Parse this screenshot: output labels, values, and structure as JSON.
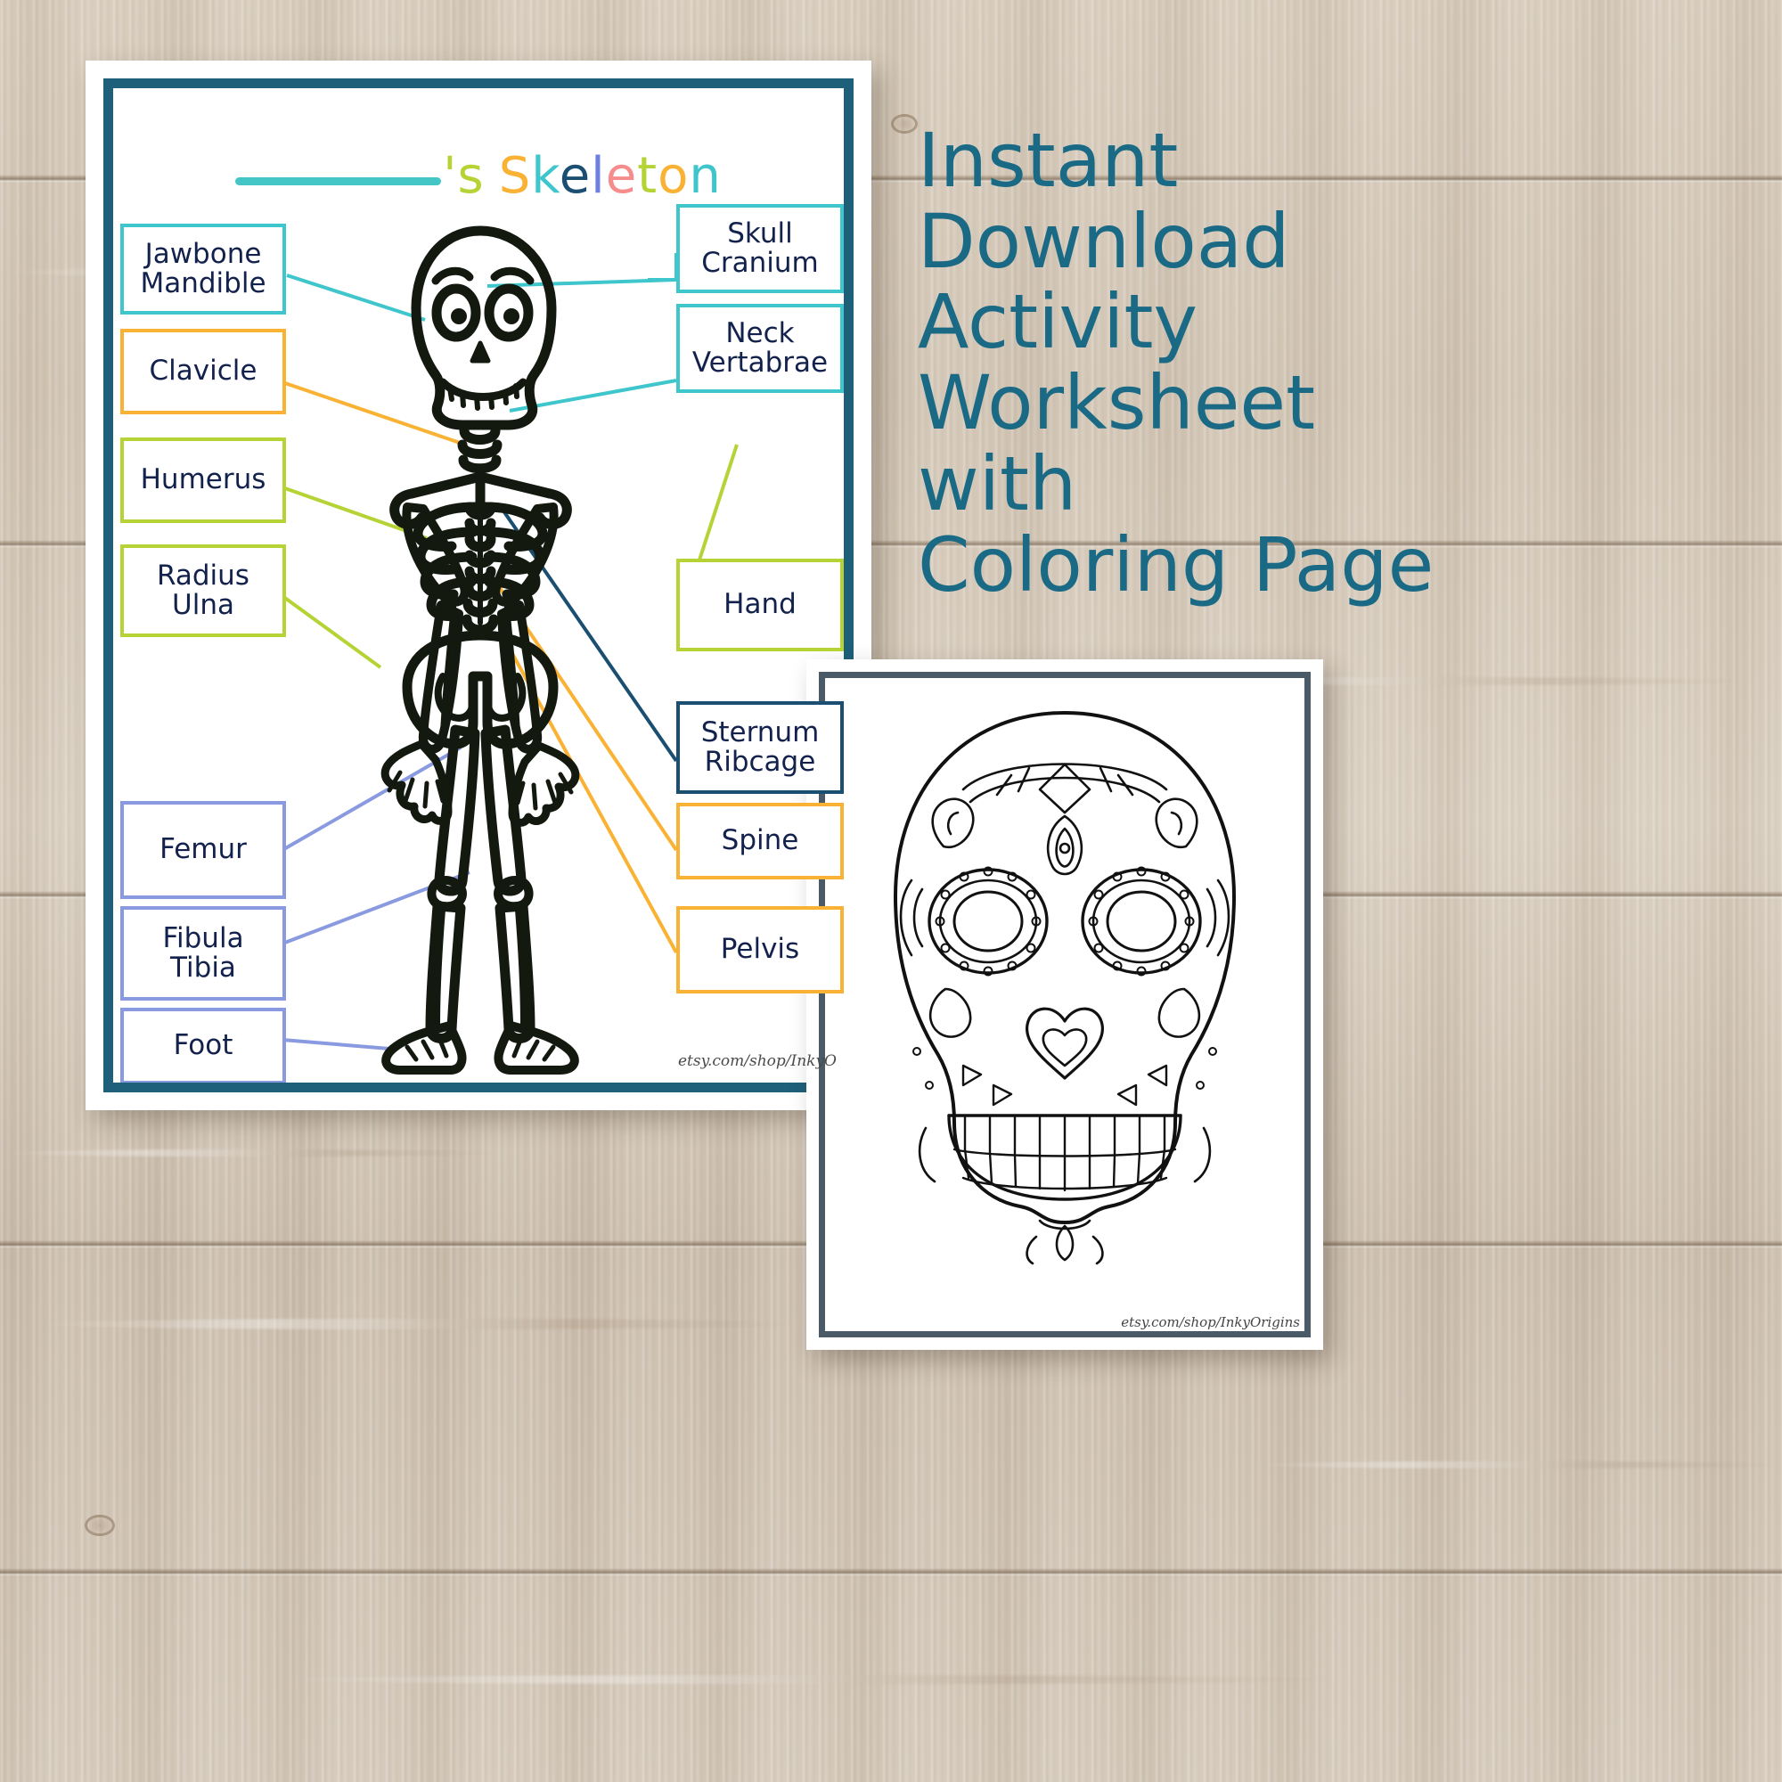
{
  "promo": {
    "lines": [
      "Instant",
      "Download",
      "Activity",
      "Worksheet",
      "with",
      "Coloring Page"
    ],
    "color": "#1a6a85"
  },
  "worksheet": {
    "border_color": "#1e5f7a",
    "title": {
      "blank_line": "",
      "apostrophe_s": "'s",
      "word": "Skeleton",
      "letters": [
        {
          "ch": "'",
          "color": "#b5d334"
        },
        {
          "ch": "s",
          "color": "#b5d334"
        },
        {
          "ch": "S",
          "color": "#f9b233"
        },
        {
          "ch": "k",
          "color": "#3fc6cc"
        },
        {
          "ch": "e",
          "color": "#1a4f72"
        },
        {
          "ch": "l",
          "color": "#6f7fe0"
        },
        {
          "ch": "e",
          "color": "#f78c8c"
        },
        {
          "ch": "t",
          "color": "#b5d334"
        },
        {
          "ch": "o",
          "color": "#f9b233"
        },
        {
          "ch": "n",
          "color": "#3fc6cc"
        }
      ]
    },
    "labels_left": [
      {
        "id": "jawbone",
        "lines": [
          "Jawbone",
          "Mandible"
        ],
        "color": "#3fc6cc"
      },
      {
        "id": "clavicle",
        "lines": [
          "Clavicle"
        ],
        "color": "#f9b233"
      },
      {
        "id": "humerus",
        "lines": [
          "Humerus"
        ],
        "color": "#b5d334"
      },
      {
        "id": "radius-ulna",
        "lines": [
          "Radius",
          "Ulna"
        ],
        "color": "#b5d334"
      },
      {
        "id": "femur",
        "lines": [
          "Femur"
        ],
        "color": "#8a9ae0"
      },
      {
        "id": "fibula-tibia",
        "lines": [
          "Fibula",
          "Tibia"
        ],
        "color": "#8a9ae0"
      },
      {
        "id": "foot",
        "lines": [
          "Foot"
        ],
        "color": "#8a9ae0"
      }
    ],
    "labels_right": [
      {
        "id": "skull-cranium",
        "lines": [
          "Skull",
          "Cranium"
        ],
        "color": "#3fc6cc"
      },
      {
        "id": "neck-vertabrae",
        "lines": [
          "Neck",
          "Vertabrae"
        ],
        "color": "#3fc6cc"
      },
      {
        "id": "hand",
        "lines": [
          "Hand"
        ],
        "color": "#b5d334"
      },
      {
        "id": "sternum-ribcage",
        "lines": [
          "Sternum",
          "Ribcage"
        ],
        "color": "#1a4f72"
      },
      {
        "id": "spine",
        "lines": [
          "Spine"
        ],
        "color": "#f9b233"
      },
      {
        "id": "pelvis",
        "lines": [
          "Pelvis"
        ],
        "color": "#f9b233"
      }
    ],
    "watermark": "etsy.com/shop/InkyO"
  },
  "coloring_page": {
    "border_color": "#4a5a66",
    "subject": "sugar-skull",
    "watermark": "etsy.com/shop/InkyOrigins"
  }
}
